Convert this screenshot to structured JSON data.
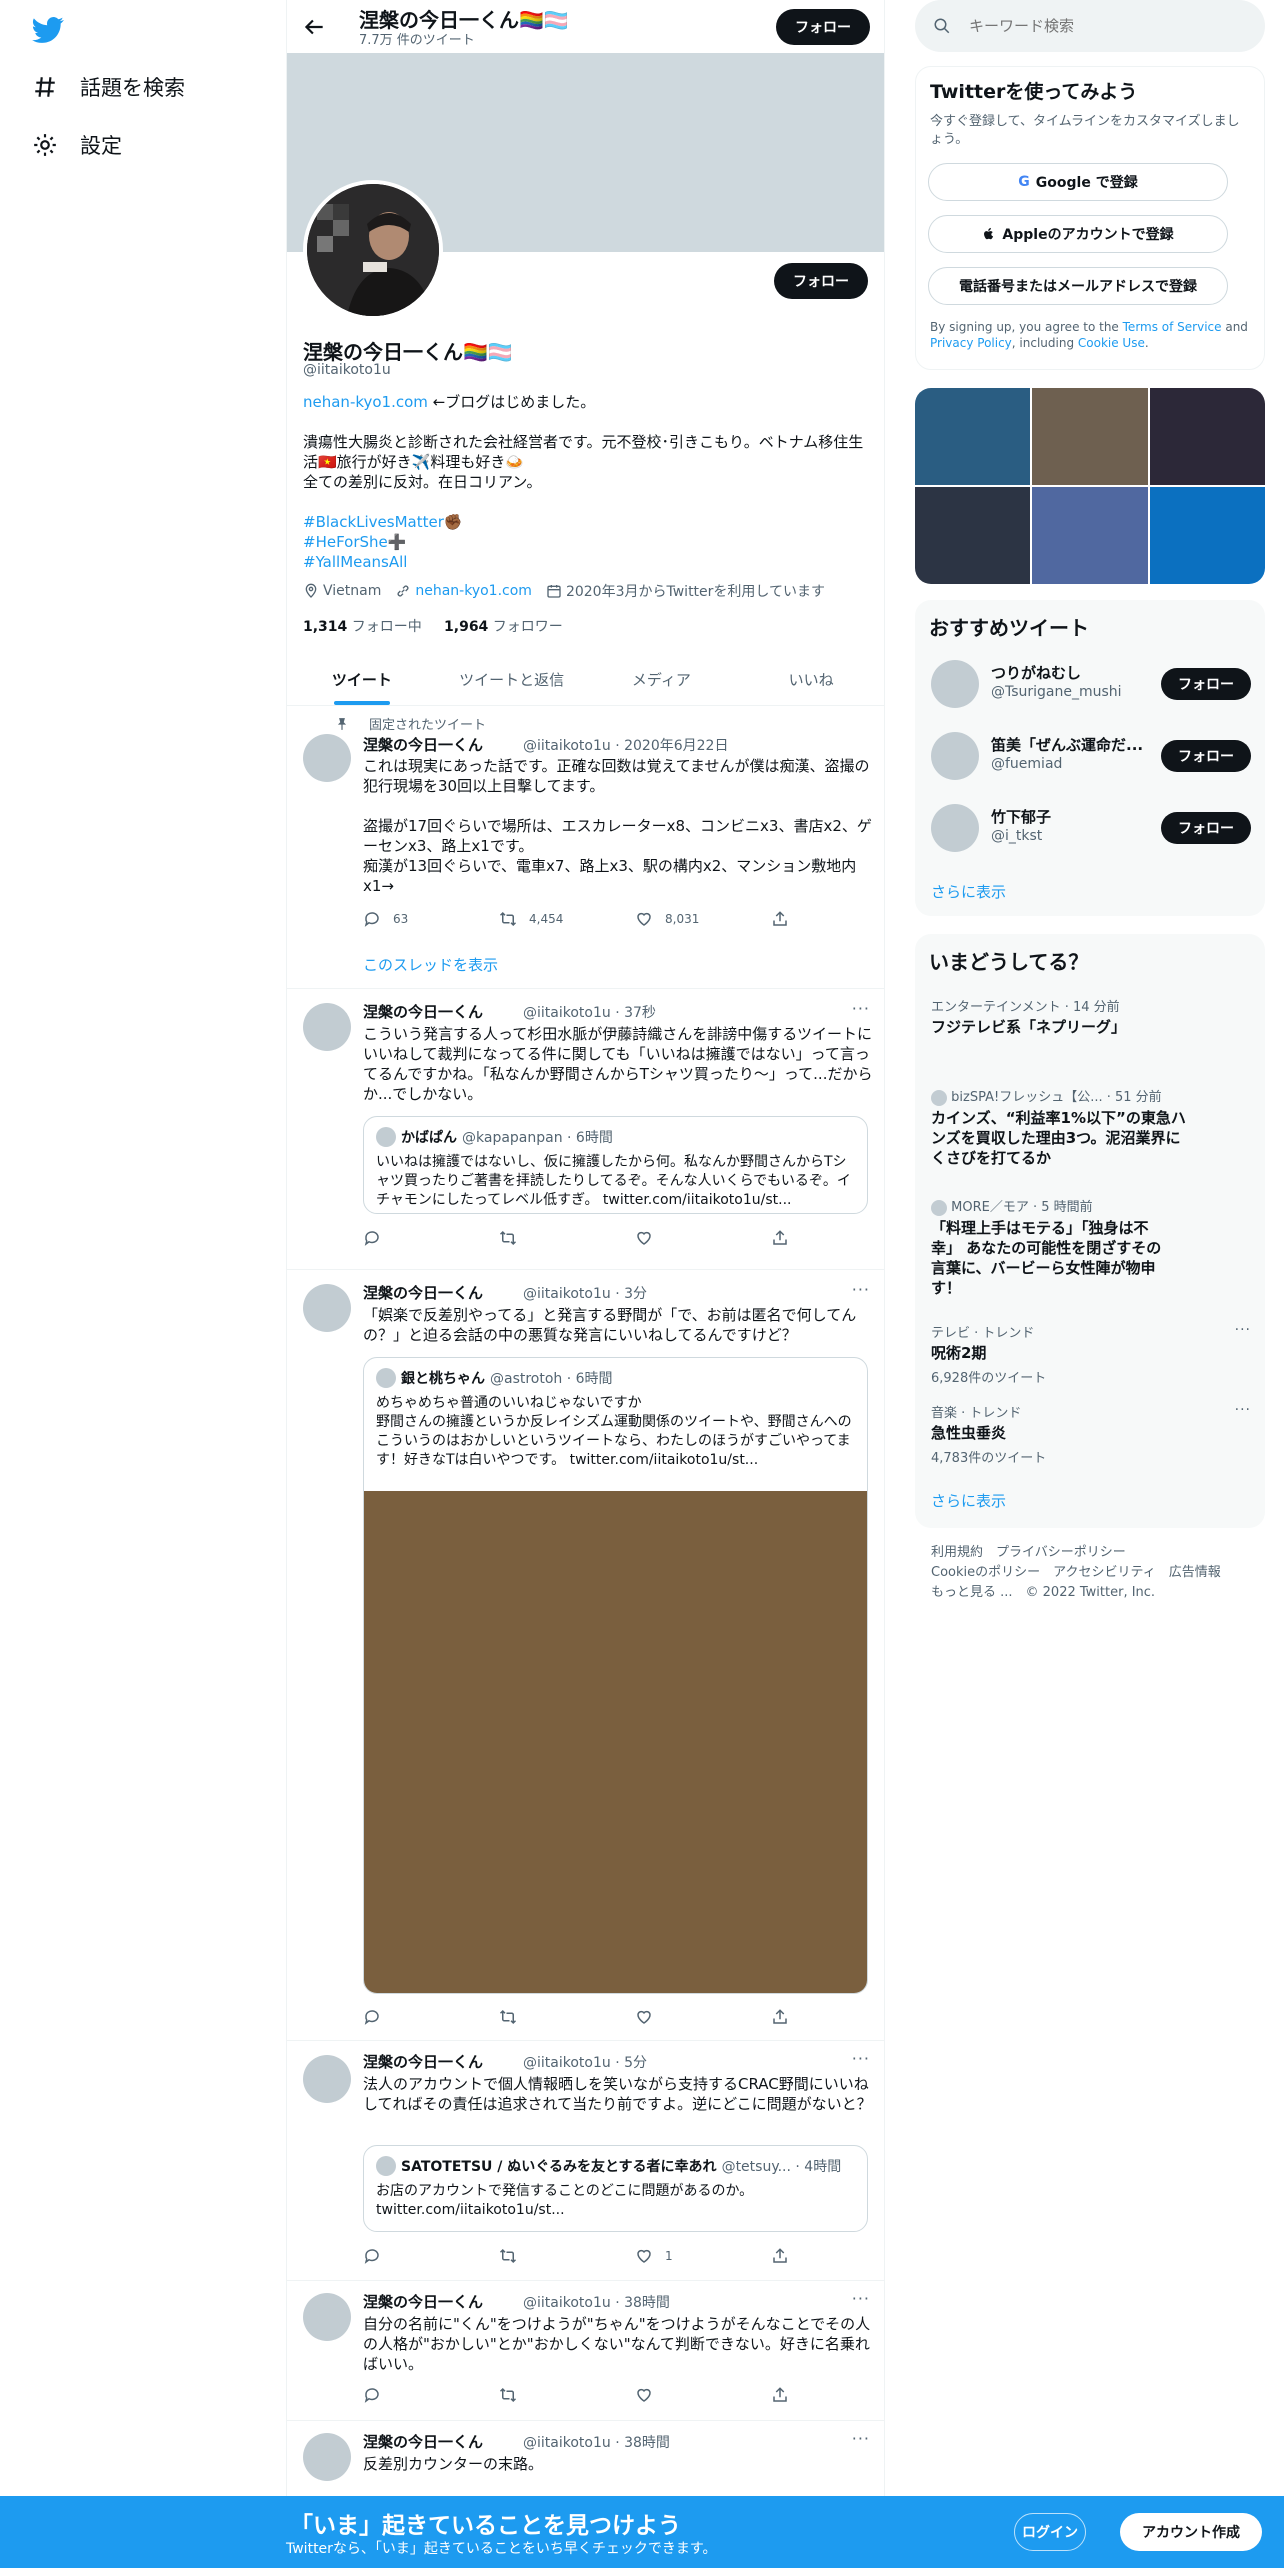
{
  "nav": {
    "explore": "話題を検索",
    "settings": "設定"
  },
  "header": {
    "name": "涅槃の今日一くん🏳️‍🌈🏳️‍⚧️",
    "count": "7.7万 件のツイート",
    "follow": "フォロー"
  },
  "profile": {
    "follow": "フォロー",
    "name": "涅槃の今日一くん🏳️‍🌈🏳️‍⚧️",
    "handle": "@iitaikoto1u",
    "bio_link": "nehan-kyo1.com",
    "bio_line1_rest": " ←ブログはじめました。",
    "bio_line2": "潰瘍性大腸炎と診断された会社経営者です。元不登校･引きこもり。ベトナム移住生",
    "bio_line3": "活🇻🇳旅行が好き✈️料理も好き🍛",
    "bio_line4": "全ての差別に反対。在日コリアン。",
    "hashtag1": "#BlackLivesMatter✊🏾",
    "hashtag2": "#HeForShe➕",
    "hashtag3": "#YallMeansAll",
    "location": "Vietnam",
    "website": "nehan-kyo1.com",
    "joined": "2020年3月からTwitterを利用しています",
    "following_count": "1,314",
    "following_label": " フォロー中",
    "followers_count": "1,964",
    "followers_label": " フォロワー"
  },
  "tabs": [
    "ツイート",
    "ツイートと返信",
    "メディア",
    "いいね"
  ],
  "tweets": [
    {
      "pinned": "固定されたツイート",
      "name": "涅槃の今日一くん",
      "meta": "@iitaikoto1u · 2020年6月22日",
      "text": "これは現実にあった話です。正確な回数は覚えてませんが僕は痴漢、盗撮の犯行現場を30回以上目撃してます。\n\n盗撮が17回ぐらいで場所は、エスカレーターx8、コンビニx3、書店x2、ゲーセンx3、路上x1です。\n痴漢が13回ぐらいで、電車x7、路上x3、駅の構内x2、マンション敷地内x1→",
      "replies": "63",
      "retweets": "4,454",
      "likes": "8,031",
      "thread": "このスレッドを表示"
    },
    {
      "name": "涅槃の今日一くん",
      "meta": "@iitaikoto1u · 37秒",
      "text": "こういう発言する人って杉田水脈が伊藤詩織さんを誹謗中傷するツイートにいいねして裁判になってる件に関しても「いいねは擁護ではない」って言ってるんですかね。「私なんか野間さんからTシャツ買ったり〜」って...だからか...でしかない。",
      "quote_name": "かばぱん",
      "quote_meta": "@kapapanpan · 6時間",
      "quote_text": "いいねは擁護ではないし、仮に擁護したから何。私なんか野間さんからTシャツ買ったりご著書を拝読したりしてるぞ。そんな人いくらでもいるぞ。イチャモンにしたってレベル低すぎ。 twitter.com/iitaikoto1u/st..."
    },
    {
      "name": "涅槃の今日一くん",
      "meta": "@iitaikoto1u · 3分",
      "text": "「娯楽で反差別やってる」と発言する野間が「で、お前は匿名で何してんの？」と迫る会話の中の悪質な発言にいいねしてるんですけど？",
      "quote_name": "銀と桃ちゃん",
      "quote_meta": "@astrotoh · 6時間",
      "quote_text": "めちゃめちゃ普通のいいねじゃないですか\n野間さんの擁護というか反レイシズム運動関係のツイートや、野間さんへのこういうのはおかしいというツイートなら、わたしのほうがすごいやってます！好きなTは白いやつです。 twitter.com/iitaikoto1u/st...",
      "media_color": "#7a5f3e"
    },
    {
      "name": "涅槃の今日一くん",
      "meta": "@iitaikoto1u · 5分",
      "text": "法人のアカウントで個人情報晒しを笑いながら支持するCRAC野間にいいねしてればその責任は追求されて当たり前ですよ。逆にどこに問題がないと？",
      "quote_name": "SATOTETSU / ぬいぐるみを友とする者に幸あれ",
      "quote_meta": "@tetsuy... · 4時間",
      "quote_text": "お店のアカウントで発信することのどこに問題があるのか。\ntwitter.com/iitaikoto1u/st...",
      "likes": "1"
    },
    {
      "name": "涅槃の今日一くん",
      "meta": "@iitaikoto1u · 38時間",
      "text": "自分の名前に\"くん\"をつけようが\"ちゃん\"をつけようがそんなことでその人の人格が\"おかしい\"とか\"おかしくない\"なんて判断できない。好きに名乗ればいい。"
    },
    {
      "name": "涅槃の今日一くん",
      "meta": "@iitaikoto1u · 38時間",
      "text": "反差別カウンターの末路。"
    }
  ],
  "search": {
    "placeholder": "キーワード検索"
  },
  "signup": {
    "title": "Twitterを使ってみよう",
    "sub": "今すぐ登録して、タイムラインをカスタマイズしましょう。",
    "google": "Google で登録",
    "apple": "Appleのアカウントで登録",
    "phone": "電話番号またはメールアドレスで登録",
    "legal_pre": "By signing up, you agree to the ",
    "terms": "Terms of Service",
    "legal_and": " and ",
    "privacy": "Privacy Policy",
    "legal_incl": ", including ",
    "cookie": "Cookie Use",
    "legal_end": "."
  },
  "photo_colors": [
    "#2a5d82",
    "#6e6050",
    "#2c2838",
    "#2c3444",
    "#5068a0",
    "#0b70c0"
  ],
  "recommend": {
    "title": "おすすめツイート",
    "users": [
      {
        "name": "つりがねむし",
        "handle": "@Tsurigane_mushi",
        "btn": "フォロー"
      },
      {
        "name": "笛美「ぜんぶ運命だ...",
        "handle": "@fuemiad",
        "btn": "フォロー"
      },
      {
        "name": "竹下郁子",
        "handle": "@i_tkst",
        "btn": "フォロー"
      }
    ],
    "more": "さらに表示"
  },
  "trends": {
    "title": "いまどうしてる？",
    "items": [
      {
        "context": "エンターテインメント · 14 分前",
        "title": "フジテレビ系「ネプリーグ」"
      },
      {
        "context": "bizSPA!フレッシュ【公... · 51 分前",
        "title": "カインズ、“利益率1%以下”の東急ハンズを買収した理由3つ。泥沼業界にくさびを打てるか"
      },
      {
        "context": "MORE／モア · 5 時間前",
        "title": "「料理上手はモテる」「独身は不幸」 あなたの可能性を閉ざすその言葉に、バービーら女性陣が物申す！"
      },
      {
        "context": "テレビ · トレンド",
        "title": "呪術2期",
        "count": "6,928件のツイート"
      },
      {
        "context": "音楽 · トレンド",
        "title": "急性虫垂炎",
        "count": "4,783件のツイート"
      }
    ],
    "more": "さらに表示"
  },
  "footer": {
    "l1": "利用規約　プライバシーポリシー",
    "l2": "Cookieのポリシー　アクセシビリティ　広告情報",
    "l3": "もっと見る ...　© 2022 Twitter, Inc."
  },
  "bottom": {
    "title": "「いま」起きていることを見つけよう",
    "sub": "Twitterなら、「いま」起きていることをいち早くチェックできます。",
    "login": "ログイン",
    "signup": "アカウント作成"
  },
  "colors": {
    "accent": "#1d9bf0",
    "dark": "#0f1419"
  }
}
